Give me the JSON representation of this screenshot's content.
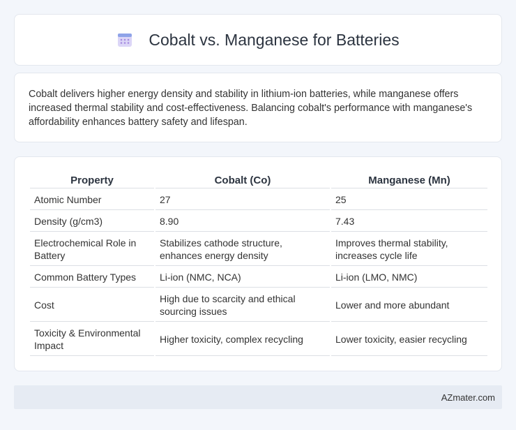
{
  "header": {
    "title": "Cobalt vs. Manganese for Batteries",
    "icon": "calendar-icon"
  },
  "intro": {
    "text": "Cobalt delivers higher energy density and stability in lithium-ion batteries, while manganese offers increased thermal stability and cost-effectiveness. Balancing cobalt's performance with manganese's affordability enhances battery safety and lifespan."
  },
  "table": {
    "headers": [
      "Property",
      "Cobalt (Co)",
      "Manganese (Mn)"
    ],
    "rows": [
      [
        "Atomic Number",
        "27",
        "25"
      ],
      [
        "Density (g/cm3)",
        "8.90",
        "7.43"
      ],
      [
        "Electrochemical Role in Battery",
        "Stabilizes cathode structure, enhances energy density",
        "Improves thermal stability, increases cycle life"
      ],
      [
        "Common Battery Types",
        "Li-ion (NMC, NCA)",
        "Li-ion (LMO, NMC)"
      ],
      [
        "Cost",
        "High due to scarcity and ethical sourcing issues",
        "Lower and more abundant"
      ],
      [
        "Toxicity & Environmental Impact",
        "Higher toxicity, complex recycling",
        "Lower toxicity, easier recycling"
      ]
    ]
  },
  "footer": {
    "text": "AZmater.com"
  }
}
